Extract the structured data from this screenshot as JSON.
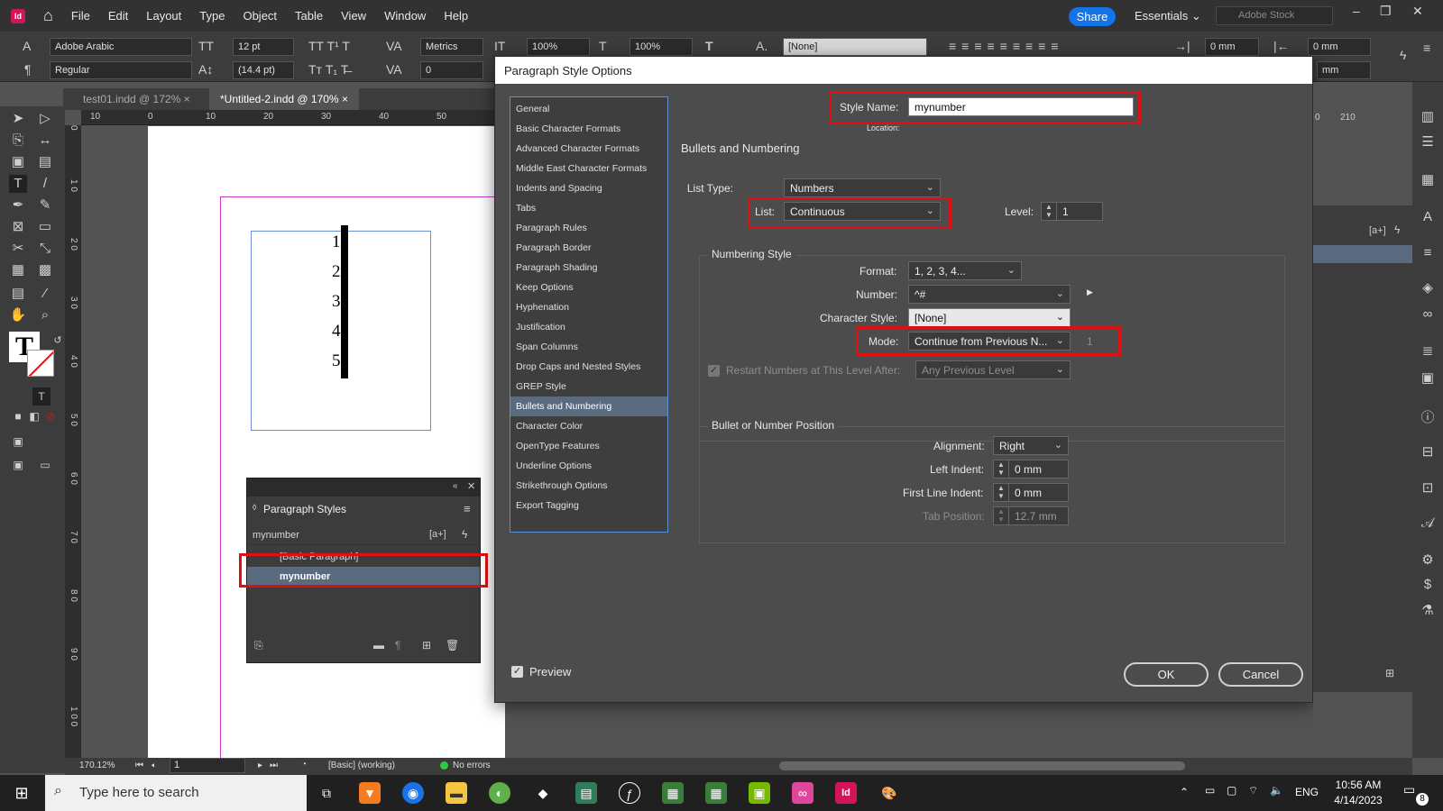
{
  "app": {
    "logo": "Id",
    "menu": [
      "File",
      "Edit",
      "Layout",
      "Type",
      "Object",
      "Table",
      "View",
      "Window",
      "Help"
    ],
    "share": "Share",
    "workspace": "Essentials",
    "stock_placeholder": "Adobe Stock"
  },
  "control_bar": {
    "font_family": "Adobe Arabic",
    "font_style": "Regular",
    "font_size": "12 pt",
    "leading": "(14.4 pt)",
    "kerning": "Metrics",
    "tracking": "0",
    "vscale": "100%",
    "hscale": "100%",
    "char_style": "[None]",
    "left_indent": "0 mm",
    "right_indent": "0 mm",
    "space_after": "mm"
  },
  "tabs": [
    {
      "label": "test01.indd @ 172%",
      "close": "×"
    },
    {
      "label": "*Untitled-2.indd @ 170%",
      "close": "×"
    }
  ],
  "ruler": {
    "h_ticks": [
      "10",
      "0",
      "10",
      "20",
      "30",
      "40",
      "50"
    ],
    "h_right": [
      "0",
      "210"
    ],
    "v_ticks": [
      "0",
      "1 0",
      "2 0",
      "3 0",
      "4 0",
      "5 0",
      "6 0",
      "7 0",
      "8 0",
      "9 0",
      "1 0 0"
    ]
  },
  "document": {
    "numbers": [
      "1",
      "2",
      "3",
      "4",
      "5"
    ]
  },
  "paragraph_styles_panel": {
    "title": "Paragraph Styles",
    "current": "mynumber",
    "styles": [
      "[Basic Paragraph]",
      "mynumber"
    ]
  },
  "dialog": {
    "title": "Paragraph Style Options",
    "categories": [
      "General",
      "Basic Character Formats",
      "Advanced Character Formats",
      "Middle East Character Formats",
      "Indents and Spacing",
      "Tabs",
      "Paragraph Rules",
      "Paragraph Border",
      "Paragraph Shading",
      "Keep Options",
      "Hyphenation",
      "Justification",
      "Span Columns",
      "Drop Caps and Nested Styles",
      "GREP Style",
      "Bullets and Numbering",
      "Character Color",
      "OpenType Features",
      "Underline Options",
      "Strikethrough Options",
      "Export Tagging"
    ],
    "selected_category": "Bullets and Numbering",
    "style_name_label": "Style Name:",
    "style_name": "mynumber",
    "location_label": "Location:",
    "section_title": "Bullets and Numbering",
    "list_type_label": "List Type:",
    "list_type": "Numbers",
    "list_label": "List:",
    "list": "Continuous",
    "level_label": "Level:",
    "level": "1",
    "numbering_style_title": "Numbering Style",
    "format_label": "Format:",
    "format": "1, 2, 3, 4...",
    "number_label": "Number:",
    "number": "^#",
    "char_style_label": "Character Style:",
    "char_style": "[None]",
    "mode_label": "Mode:",
    "mode": "Continue from Previous N...",
    "mode_value": "1",
    "restart_label": "Restart Numbers at This Level After:",
    "restart_value": "Any Previous Level",
    "position_title": "Bullet or Number Position",
    "alignment_label": "Alignment:",
    "alignment": "Right",
    "left_indent_label": "Left Indent:",
    "left_indent": "0 mm",
    "first_line_label": "First Line Indent:",
    "first_line": "0 mm",
    "tab_position_label": "Tab Position:",
    "tab_position": "12.7 mm",
    "preview_label": "Preview",
    "ok": "OK",
    "cancel": "Cancel"
  },
  "status_bar": {
    "zoom": "170.12%",
    "page": "1",
    "profile": "[Basic] (working)",
    "errors": "No errors"
  },
  "taskbar": {
    "search_placeholder": "Type here to search",
    "lang": "ENG",
    "time": "10:56 AM",
    "date": "4/14/2023",
    "notifications": "8"
  },
  "colors": {
    "highlight": "#e01010",
    "accent": "#1473e6",
    "indesign": "#d4145a"
  }
}
